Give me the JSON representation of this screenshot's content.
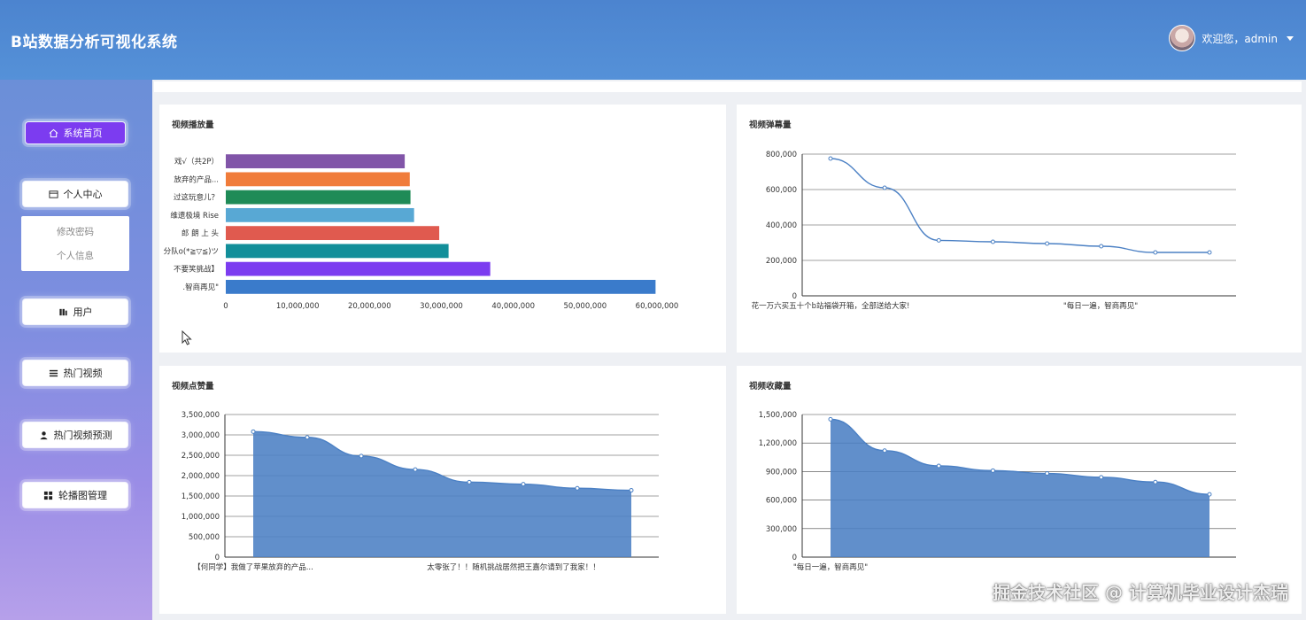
{
  "header": {
    "title": "B站数据分析可视化系统",
    "welcome": "欢迎您，admin"
  },
  "sidebar": {
    "items": [
      {
        "label": "系统首页",
        "icon": "home-icon"
      },
      {
        "label": "个人中心",
        "icon": "profile-card-icon"
      },
      {
        "label": "用户",
        "icon": "user-bars-icon"
      },
      {
        "label": "热门视频",
        "icon": "list-icon"
      },
      {
        "label": "热门视频预测",
        "icon": "person-icon"
      },
      {
        "label": "轮播图管理",
        "icon": "grid-icon"
      }
    ],
    "submenu": [
      "修改密码",
      "个人信息"
    ]
  },
  "charts": {
    "plays": {
      "title": "视频播放量"
    },
    "danmaku": {
      "title": "视频弹幕量"
    },
    "likes": {
      "title": "视频点赞量"
    },
    "favorites": {
      "title": "视频收藏量"
    }
  },
  "chart_data": [
    {
      "type": "bar",
      "orientation": "horizontal",
      "title": "视频播放量",
      "categories": [
        ".智商再见\"",
        "不要笑挑战】",
        "分队o(*≧▽≦)ツ",
        "郎 朗 上 头",
        "维遗极境 Rise",
        "过这玩意儿？",
        "放弃的产品...",
        "戏√（共2P）"
      ],
      "values": [
        59800000,
        36800000,
        31000000,
        29700000,
        26200000,
        25700000,
        25600000,
        24900000
      ],
      "xticks": [
        "0",
        "10,000,000",
        "20,000,000",
        "30,000,000",
        "40,000,000",
        "50,000,000",
        "60,000,000"
      ],
      "xlim": [
        0,
        60000000
      ],
      "colors": [
        "#3a7bcb",
        "#7c3cf0",
        "#128f9a",
        "#e05a4f",
        "#58a8d4",
        "#1f8b57",
        "#f07c3a",
        "#8155a8"
      ]
    },
    {
      "type": "line",
      "title": "视频弹幕量",
      "values": [
        775000,
        610000,
        313000,
        305000,
        295000,
        280000,
        245000,
        245000
      ],
      "ylim": [
        0,
        800000
      ],
      "yticks": [
        "0",
        "200,000",
        "400,000",
        "600,000",
        "800,000"
      ],
      "xlabels": [
        "花一万六买五十个b站福袋开箱，全部送给大家!",
        "\"每日一遍，智商再见\""
      ],
      "color": "#4b80c4"
    },
    {
      "type": "area",
      "title": "视频点赞量",
      "values": [
        3080000,
        2940000,
        2480000,
        2150000,
        1840000,
        1790000,
        1690000,
        1640000
      ],
      "ylim": [
        0,
        3500000
      ],
      "yticks": [
        "0",
        "500,000",
        "1,000,000",
        "1,500,000",
        "2,000,000",
        "2,500,000",
        "3,000,000",
        "3,500,000"
      ],
      "xlabels": [
        "【何同学】我做了苹果放弃的产品...",
        "太零张了！！随机挑战居然把王嘉尔请到了我家！！"
      ],
      "color": "#4b80c4"
    },
    {
      "type": "area",
      "title": "视频收藏量",
      "values": [
        1450000,
        1120000,
        960000,
        910000,
        880000,
        840000,
        790000,
        660000
      ],
      "ylim": [
        0,
        1500000
      ],
      "yticks": [
        "0",
        "300,000",
        "600,000",
        "900,000",
        "1,200,000",
        "1,500,000"
      ],
      "xlabels": [
        "\"每日一遍，智商再见\""
      ],
      "color": "#4b80c4"
    }
  ],
  "watermark": "掘金技术社区 @ 计算机毕业设计杰瑞"
}
